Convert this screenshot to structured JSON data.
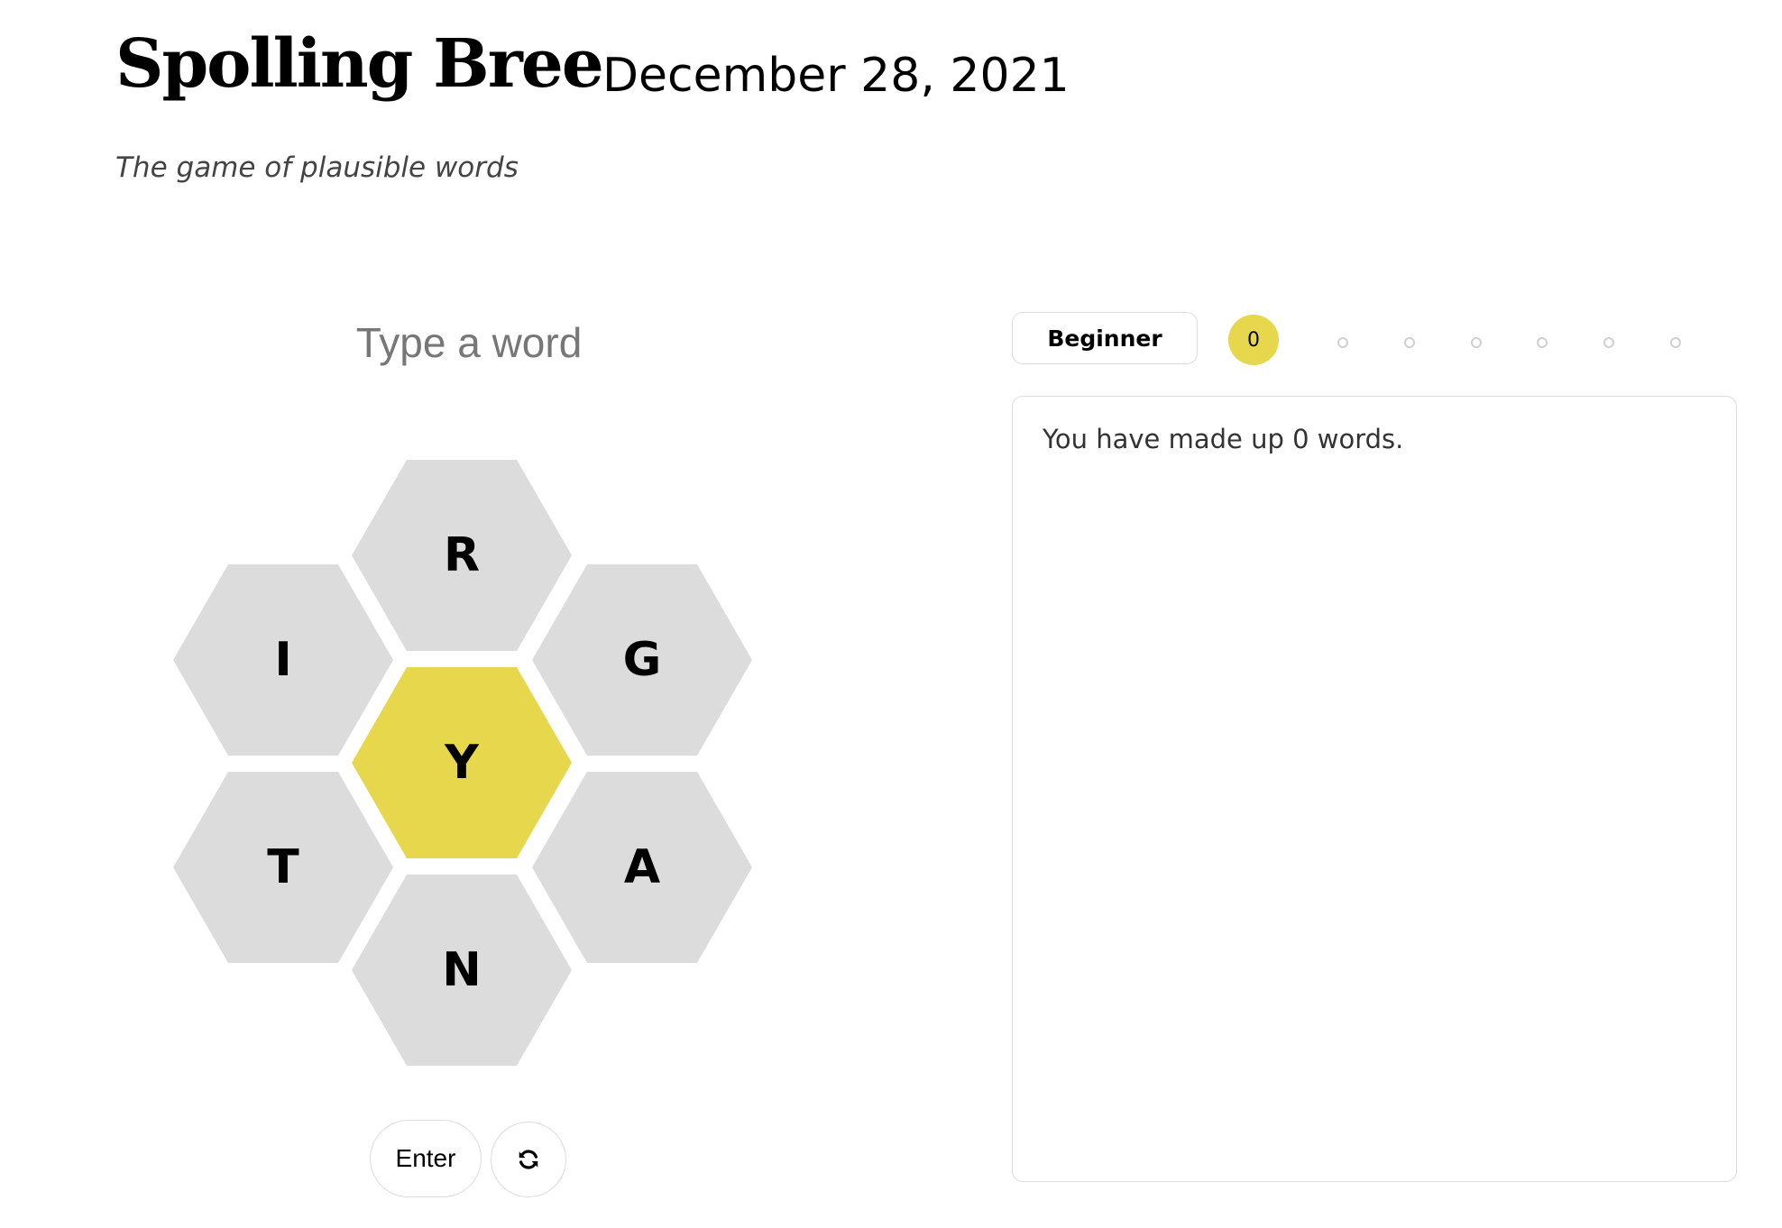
{
  "header": {
    "title": "Spolling Bree",
    "date": "December 28, 2021",
    "subtitle": "The game of plausible words"
  },
  "input": {
    "placeholder": "Type a word",
    "value": ""
  },
  "hive": {
    "center_letter": "Y",
    "outer_letters": {
      "top": "R",
      "upper_left": "I",
      "upper_right": "G",
      "lower_left": "T",
      "lower_right": "A",
      "bottom": "N"
    },
    "center_color": "#e6d74c",
    "outer_color": "#dcdcdc"
  },
  "controls": {
    "enter_label": "Enter",
    "shuffle_icon": "refresh-icon"
  },
  "progress": {
    "rank_label": "Beginner",
    "score": "0",
    "steps_remaining": 6,
    "accent_color": "#e6d74c"
  },
  "word_list": {
    "summary": "You have made up 0 words."
  }
}
